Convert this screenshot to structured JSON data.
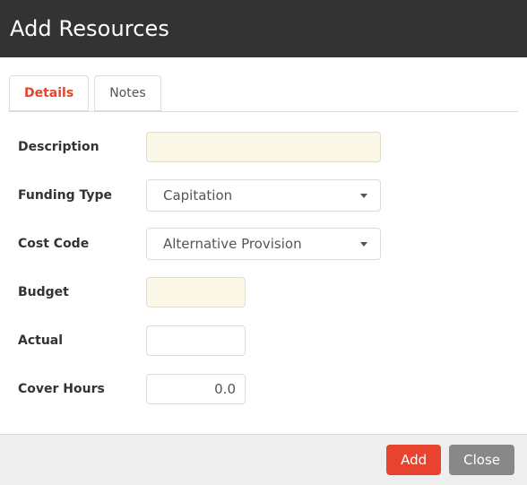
{
  "header": {
    "title": "Add Resources"
  },
  "tabs": [
    {
      "label": "Details",
      "active": true
    },
    {
      "label": "Notes",
      "active": false
    }
  ],
  "form": {
    "fields": [
      {
        "label": "Description",
        "type": "text",
        "value": "",
        "placeholder": "",
        "required": true,
        "width": "wide"
      },
      {
        "label": "Funding Type",
        "type": "select",
        "value": "Capitation",
        "required": false,
        "width": "wide"
      },
      {
        "label": "Cost Code",
        "type": "select",
        "value": "Alternative Provision",
        "required": false,
        "width": "wide"
      },
      {
        "label": "Budget",
        "type": "text",
        "value": "",
        "placeholder": "",
        "required": true,
        "width": "narrow"
      },
      {
        "label": "Actual",
        "type": "text",
        "value": "",
        "placeholder": "",
        "required": false,
        "width": "narrow"
      },
      {
        "label": "Cover Hours",
        "type": "text",
        "value": "0.0",
        "placeholder": "",
        "required": false,
        "width": "narrow",
        "align": "right"
      }
    ]
  },
  "footer": {
    "add_label": "Add",
    "close_label": "Close"
  },
  "colors": {
    "header_bg": "#333333",
    "accent": "#e8432e",
    "secondary": "#888888",
    "required_field_bg": "#fcf8e8",
    "footer_bg": "#eeeeee"
  }
}
